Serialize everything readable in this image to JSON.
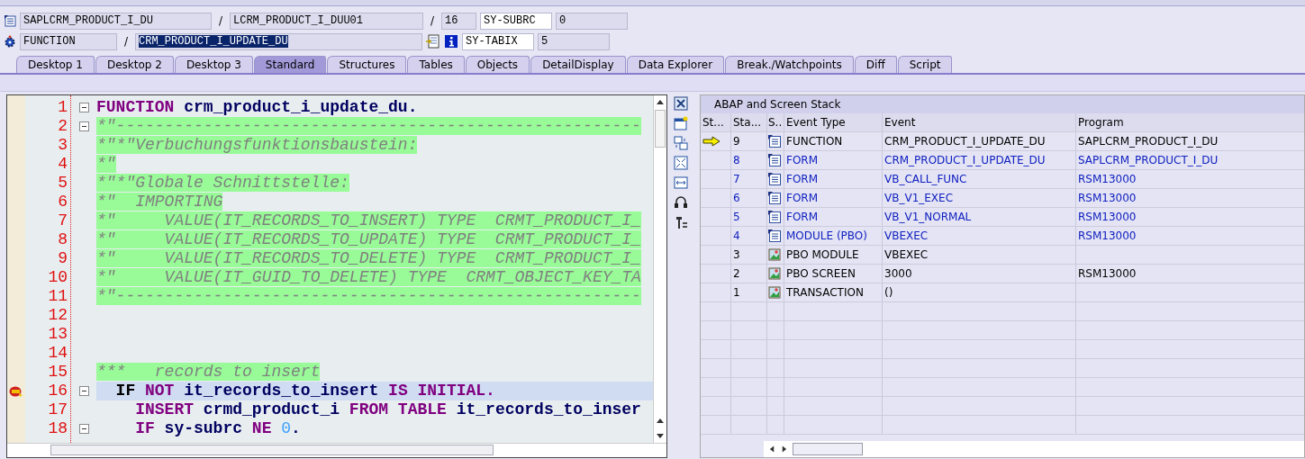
{
  "header": {
    "row1": {
      "program": "SAPLCRM_PRODUCT_I_DU",
      "include": "LCRM_PRODUCT_I_DUU01",
      "line": "16",
      "var_name": "SY-SUBRC",
      "var_value": "0"
    },
    "row2": {
      "type": "FUNCTION",
      "name": "CRM_PRODUCT_I_UPDATE_DU",
      "var_name": "SY-TABIX",
      "var_value": "5"
    },
    "separator": "/"
  },
  "tabs": [
    {
      "label": "Desktop 1",
      "selected": false
    },
    {
      "label": "Desktop 2",
      "selected": false
    },
    {
      "label": "Desktop 3",
      "selected": false
    },
    {
      "label": "Standard",
      "selected": true
    },
    {
      "label": "Structures",
      "selected": false
    },
    {
      "label": "Tables",
      "selected": false
    },
    {
      "label": "Objects",
      "selected": false
    },
    {
      "label": "DetailDisplay",
      "selected": false
    },
    {
      "label": "Data Explorer",
      "selected": false
    },
    {
      "label": "Break./Watchpoints",
      "selected": false
    },
    {
      "label": "Diff",
      "selected": false
    },
    {
      "label": "Script",
      "selected": false
    }
  ],
  "editor": {
    "lines": [
      {
        "number": "1",
        "foldable": true,
        "current": false,
        "breakpoint": false,
        "segments": [
          {
            "kind": "keyword",
            "text": "FUNCTION"
          },
          {
            "kind": "ident",
            "text": " crm_product_i_update_du."
          }
        ]
      },
      {
        "number": "2",
        "foldable": true,
        "current": false,
        "breakpoint": false,
        "segments": [
          {
            "kind": "comment",
            "text": "*\"------------------------------------------------------"
          }
        ]
      },
      {
        "number": "3",
        "foldable": false,
        "current": false,
        "breakpoint": false,
        "segments": [
          {
            "kind": "comment",
            "text": "*\"*\"Verbuchungsfunktionsbaustein:"
          }
        ]
      },
      {
        "number": "4",
        "foldable": false,
        "current": false,
        "breakpoint": false,
        "segments": [
          {
            "kind": "comment",
            "text": "*\""
          }
        ]
      },
      {
        "number": "5",
        "foldable": false,
        "current": false,
        "breakpoint": false,
        "segments": [
          {
            "kind": "comment",
            "text": "*\"*\"Globale Schnittstelle:"
          }
        ]
      },
      {
        "number": "6",
        "foldable": false,
        "current": false,
        "breakpoint": false,
        "segments": [
          {
            "kind": "comment",
            "text": "*\"  IMPORTING"
          }
        ]
      },
      {
        "number": "7",
        "foldable": false,
        "current": false,
        "breakpoint": false,
        "segments": [
          {
            "kind": "comment",
            "text": "*\"     VALUE(IT_RECORDS_TO_INSERT) TYPE  CRMT_PRODUCT_I_"
          }
        ]
      },
      {
        "number": "8",
        "foldable": false,
        "current": false,
        "breakpoint": false,
        "segments": [
          {
            "kind": "comment",
            "text": "*\"     VALUE(IT_RECORDS_TO_UPDATE) TYPE  CRMT_PRODUCT_I_"
          }
        ]
      },
      {
        "number": "9",
        "foldable": false,
        "current": false,
        "breakpoint": false,
        "segments": [
          {
            "kind": "comment",
            "text": "*\"     VALUE(IT_RECORDS_TO_DELETE) TYPE  CRMT_PRODUCT_I_"
          }
        ]
      },
      {
        "number": "10",
        "foldable": false,
        "current": false,
        "breakpoint": false,
        "segments": [
          {
            "kind": "comment",
            "text": "*\"     VALUE(IT_GUID_TO_DELETE) TYPE  CRMT_OBJECT_KEY_TA"
          }
        ]
      },
      {
        "number": "11",
        "foldable": false,
        "current": false,
        "breakpoint": false,
        "segments": [
          {
            "kind": "comment",
            "text": "*\"------------------------------------------------------"
          }
        ]
      },
      {
        "number": "12",
        "foldable": false,
        "current": false,
        "breakpoint": false
      },
      {
        "number": "13",
        "foldable": false,
        "current": false,
        "breakpoint": false
      },
      {
        "number": "14",
        "foldable": false,
        "current": false,
        "breakpoint": false
      },
      {
        "number": "15",
        "foldable": false,
        "current": false,
        "breakpoint": false,
        "segments": [
          {
            "kind": "comment",
            "text": "***   records to insert"
          }
        ]
      },
      {
        "number": "16",
        "foldable": true,
        "current": true,
        "breakpoint": true,
        "segments": [
          {
            "kind": "plainkw",
            "text": "  IF"
          },
          {
            "kind": "keyword",
            "text": " NOT"
          },
          {
            "kind": "ident",
            "text": " it_records_to_insert"
          },
          {
            "kind": "keyword",
            "text": " IS INITIAL."
          }
        ]
      },
      {
        "number": "17",
        "foldable": false,
        "current": false,
        "breakpoint": false,
        "segments": [
          {
            "kind": "keyword",
            "text": "    INSERT"
          },
          {
            "kind": "ident",
            "text": " crmd_product_i"
          },
          {
            "kind": "keyword",
            "text": " FROM TABLE"
          },
          {
            "kind": "ident",
            "text": " it_records_to_inser"
          }
        ]
      },
      {
        "number": "18",
        "foldable": true,
        "current": false,
        "breakpoint": false,
        "segments": [
          {
            "kind": "keyword",
            "text": "    IF"
          },
          {
            "kind": "ident",
            "text": " sy-subrc"
          },
          {
            "kind": "keyword",
            "text": " NE"
          },
          {
            "kind": "number",
            "text": " 0"
          },
          {
            "kind": "ident",
            "text": "."
          }
        ]
      }
    ]
  },
  "stack": {
    "title": "ABAP and Screen Stack",
    "columns": [
      "St...",
      "Sta...",
      "S..",
      "Event Type",
      "Event",
      "Program"
    ],
    "rows": [
      {
        "current": true,
        "level": "9",
        "kind": "abap",
        "linked": false,
        "event_type": "FUNCTION",
        "event": "CRM_PRODUCT_I_UPDATE_DU",
        "program": "SAPLCRM_PRODUCT_I_DU"
      },
      {
        "current": false,
        "level": "8",
        "kind": "abap",
        "linked": true,
        "event_type": "FORM",
        "event": "CRM_PRODUCT_I_UPDATE_DU",
        "program": "SAPLCRM_PRODUCT_I_DU"
      },
      {
        "current": false,
        "level": "7",
        "kind": "abap",
        "linked": true,
        "event_type": "FORM",
        "event": "VB_CALL_FUNC",
        "program": "RSM13000"
      },
      {
        "current": false,
        "level": "6",
        "kind": "abap",
        "linked": true,
        "event_type": "FORM",
        "event": "VB_V1_EXEC",
        "program": "RSM13000"
      },
      {
        "current": false,
        "level": "5",
        "kind": "abap",
        "linked": true,
        "event_type": "FORM",
        "event": "VB_V1_NORMAL",
        "program": "RSM13000"
      },
      {
        "current": false,
        "level": "4",
        "kind": "abap",
        "linked": true,
        "event_type": "MODULE (PBO)",
        "event": "VBEXEC",
        "program": "RSM13000"
      },
      {
        "current": false,
        "level": "3",
        "kind": "screen",
        "linked": false,
        "event_type": "PBO MODULE",
        "event": "VBEXEC"
      },
      {
        "current": false,
        "level": "2",
        "kind": "screen",
        "linked": false,
        "event_type": "PBO SCREEN",
        "event": "3000",
        "program": "RSM13000"
      },
      {
        "current": false,
        "level": "1",
        "kind": "screen",
        "linked": false,
        "event_type": "TRANSACTION",
        "event": "()"
      }
    ]
  }
}
